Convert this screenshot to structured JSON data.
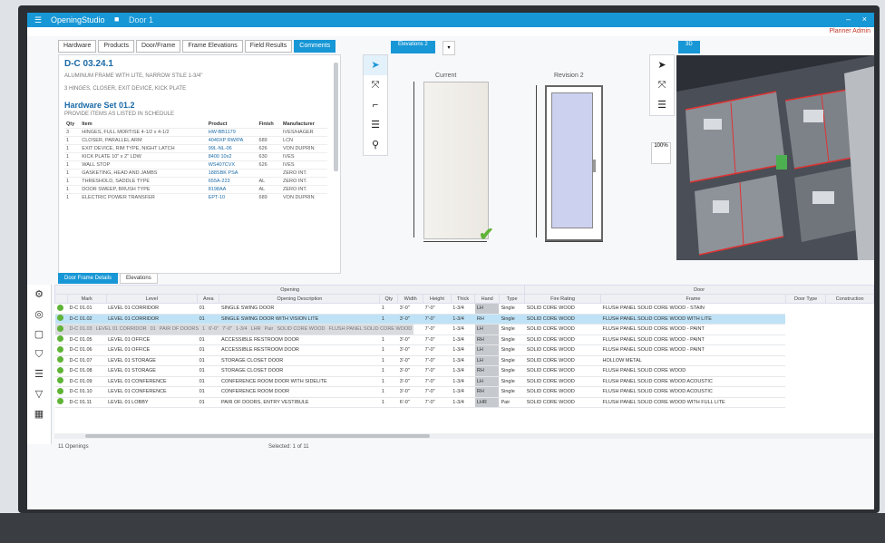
{
  "app": {
    "title": "OpeningStudio",
    "crumb": "Door 1",
    "user": "Planner Admin"
  },
  "top_tabs": [
    "Hardware",
    "Products",
    "Door/Frame",
    "Frame Elevations",
    "Field Results",
    "Comments"
  ],
  "info": {
    "doc_title": "D-C 03.24.1",
    "lines": [
      "ALUMINUM FRAME WITH LITE, NARROW STILE 1-3/4\"",
      "3 HINGES, CLOSER, EXIT DEVICE, KICK PLATE"
    ],
    "hw_title": "Hardware Set 01.2",
    "hw_sub": "PROVIDE ITEMS AS LISTED IN SCHEDULE",
    "hw_headers": [
      "Qty",
      "Item",
      "Product",
      "Finish",
      "Manufacturer"
    ],
    "hw_rows": [
      [
        "3",
        "HINGES, FULL MORTISE 4-1/2 x 4-1/2",
        "HW-BB1179",
        "",
        "IVES/HAGER"
      ],
      [
        "1",
        "CLOSER, PARALLEL ARM",
        "4040XP RW/PA",
        "689",
        "LCN"
      ],
      [
        "1",
        "EXIT DEVICE, RIM TYPE, NIGHT LATCH",
        "99L-NL-06",
        "626",
        "VON DUPRIN"
      ],
      [
        "1",
        "KICK PLATE 10\" x 2\" LDW",
        "8400 10x2",
        "630",
        "IVES"
      ],
      [
        "1",
        "WALL STOP",
        "WS407CVX",
        "626",
        "IVES"
      ],
      [
        "1",
        "GASKETING, HEAD AND JAMBS",
        "188SBK PSA",
        "",
        "ZERO INT."
      ],
      [
        "1",
        "THRESHOLD, SADDLE TYPE",
        "655A-223",
        "AL",
        "ZERO INT."
      ],
      [
        "1",
        "DOOR SWEEP, BRUSH TYPE",
        "8198AA",
        "AL",
        "ZERO INT."
      ],
      [
        "1",
        "ELECTRIC POWER TRANSFER",
        "EPT-10",
        "689",
        "VON DUPRIN"
      ]
    ]
  },
  "elevation": {
    "select_label": "Elevations 2",
    "current_label": "Current",
    "revision_label": "Revision 2"
  },
  "view3d": {
    "select_label": "3D"
  },
  "zoom": {
    "label": "100%"
  },
  "bottom_tabs": [
    "Door Frame Details",
    "Elevations"
  ],
  "grid": {
    "group_headers": [
      "Opening",
      "Door"
    ],
    "headers": [
      "",
      "Mark",
      "Level",
      "Area",
      "Opening Description",
      "Qty",
      "Width",
      "Height",
      "Thick",
      "Hand",
      "Type",
      "Fire Rating",
      "Frame",
      "Door Type",
      "Construction"
    ],
    "rows": [
      [
        "D-C 01.01",
        "LEVEL 01 CORRIDOR",
        "01",
        "SINGLE SWING DOOR",
        "1",
        "3'-0\"",
        "7'-0\"",
        "1-3/4",
        "LH",
        "Single",
        "SOLID CORE WOOD",
        "FLUSH PANEL SOLID CORE WOOD - STAIN"
      ],
      [
        "D-C 01.02",
        "LEVEL 01 CORRIDOR",
        "01",
        "SINGLE SWING DOOR WITH VISION LITE",
        "1",
        "3'-0\"",
        "7'-0\"",
        "1-3/4",
        "RH",
        "Single",
        "SOLID CORE WOOD",
        "FLUSH PANEL SOLID CORE WOOD WITH LITE"
      ],
      [
        "D-C 01.03",
        "LEVEL 01 CORRIDOR",
        "01",
        "PAIR OF DOORS",
        "1",
        "6'-0\"",
        "7'-0\"",
        "1-3/4",
        "LHR",
        "Pair",
        "SOLID CORE WOOD",
        "FLUSH PANEL SOLID CORE WOOD"
      ],
      [
        "D-C 01.04",
        "LEVEL 01 OFFICE",
        "01",
        "ACCESSIBLE RESTROOM DOOR",
        "1",
        "3'-0\"",
        "7'-0\"",
        "1-3/4",
        "LH",
        "Single",
        "SOLID CORE WOOD",
        "FLUSH PANEL SOLID CORE WOOD - PAINT"
      ],
      [
        "D-C 01.05",
        "LEVEL 01 OFFICE",
        "01",
        "ACCESSIBLE RESTROOM DOOR",
        "1",
        "3'-0\"",
        "7'-0\"",
        "1-3/4",
        "RH",
        "Single",
        "SOLID CORE WOOD",
        "FLUSH PANEL SOLID CORE WOOD - PAINT"
      ],
      [
        "D-C 01.06",
        "LEVEL 01 OFFICE",
        "01",
        "ACCESSIBLE RESTROOM DOOR",
        "1",
        "3'-0\"",
        "7'-0\"",
        "1-3/4",
        "LH",
        "Single",
        "SOLID CORE WOOD",
        "FLUSH PANEL SOLID CORE WOOD - PAINT"
      ],
      [
        "D-C 01.07",
        "LEVEL 01 STORAGE",
        "01",
        "STORAGE CLOSET DOOR",
        "1",
        "3'-0\"",
        "7'-0\"",
        "1-3/4",
        "LH",
        "Single",
        "SOLID CORE WOOD",
        "HOLLOW METAL"
      ],
      [
        "D-C 01.08",
        "LEVEL 01 STORAGE",
        "01",
        "STORAGE CLOSET DOOR",
        "1",
        "3'-0\"",
        "7'-0\"",
        "1-3/4",
        "RH",
        "Single",
        "SOLID CORE WOOD",
        "FLUSH PANEL SOLID CORE WOOD"
      ],
      [
        "D-C 01.09",
        "LEVEL 01 CONFERENCE",
        "01",
        "CONFERENCE ROOM DOOR WITH SIDELITE",
        "1",
        "3'-0\"",
        "7'-0\"",
        "1-3/4",
        "LH",
        "Single",
        "SOLID CORE WOOD",
        "FLUSH PANEL SOLID CORE WOOD ACOUSTIC"
      ],
      [
        "D-C 01.10",
        "LEVEL 01 CONFERENCE",
        "01",
        "CONFERENCE ROOM DOOR",
        "1",
        "3'-0\"",
        "7'-0\"",
        "1-3/4",
        "RH",
        "Single",
        "SOLID CORE WOOD",
        "FLUSH PANEL SOLID CORE WOOD ACOUSTIC"
      ],
      [
        "D-C 01.11",
        "LEVEL 01 LOBBY",
        "01",
        "PAIR OF DOORS, ENTRY VESTIBULE",
        "1",
        "6'-0\"",
        "7'-0\"",
        "1-3/4",
        "LHR",
        "Pair",
        "SOLID CORE WOOD",
        "FLUSH PANEL SOLID CORE WOOD WITH FULL LITE"
      ]
    ]
  },
  "status": {
    "left": "11 Openings",
    "right": "Selected: 1 of 11"
  }
}
